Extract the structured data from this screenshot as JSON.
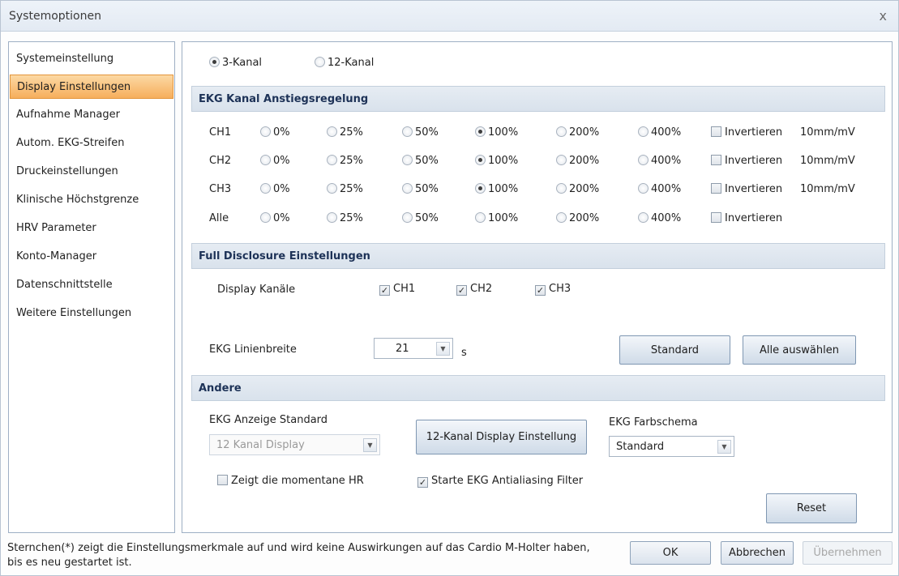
{
  "window": {
    "title": "Systemoptionen",
    "close_glyph": "x"
  },
  "sidebar": {
    "items": [
      {
        "label": "Systemeinstellung"
      },
      {
        "label": "Display Einstellungen"
      },
      {
        "label": "Aufnahme Manager"
      },
      {
        "label": "Autom. EKG-Streifen"
      },
      {
        "label": "Druckeinstellungen"
      },
      {
        "label": "Klinische Höchstgrenze"
      },
      {
        "label": "HRV Parameter"
      },
      {
        "label": "Konto-Manager"
      },
      {
        "label": "Datenschnittstelle"
      },
      {
        "label": "Weitere Einstellungen"
      }
    ],
    "active_index": 1
  },
  "channel_mode": {
    "options": [
      {
        "label": "3-Kanal",
        "selected": true
      },
      {
        "label": "12-Kanal",
        "selected": false
      }
    ]
  },
  "gain_section": {
    "title": "EKG Kanal Anstiegsregelung",
    "percent_options": [
      "0%",
      "25%",
      "50%",
      "100%",
      "200%",
      "400%"
    ],
    "invert_label": "Invertieren",
    "rows": [
      {
        "label": "CH1",
        "selected": "100%",
        "inverted": false,
        "scale": "10mm/mV"
      },
      {
        "label": "CH2",
        "selected": "100%",
        "inverted": false,
        "scale": "10mm/mV"
      },
      {
        "label": "CH3",
        "selected": "100%",
        "inverted": false,
        "scale": "10mm/mV"
      },
      {
        "label": "Alle",
        "selected": "",
        "inverted": false,
        "scale": ""
      }
    ]
  },
  "full_disclosure": {
    "title": "Full Disclosure Einstellungen",
    "display_channels_label": "Display Kanäle",
    "channels": [
      {
        "label": "CH1",
        "checked": true
      },
      {
        "label": "CH2",
        "checked": true
      },
      {
        "label": "CH3",
        "checked": true
      }
    ],
    "line_width_label": "EKG Linienbreite",
    "line_width_value": "21",
    "line_width_unit": "s",
    "standard_button": "Standard",
    "select_all_button": "Alle auswählen"
  },
  "other": {
    "title": "Andere",
    "display_default_label": "EKG Anzeige Standard",
    "display_default_value": "12 Kanal Display",
    "twelve_channel_button": "12-Kanal Display Einstellung",
    "color_scheme_label": "EKG Farbschema",
    "color_scheme_value": "Standard",
    "show_hr_label": "Zeigt die momentane HR",
    "show_hr_checked": false,
    "antialias_label": "Starte EKG Antialiasing Filter",
    "antialias_checked": true,
    "reset_button": "Reset"
  },
  "footer": {
    "note": "Sternchen(*) zeigt die Einstellungsmerkmale auf und wird keine Auswirkungen auf das Cardio M-Holter haben, bis es neu gestartet ist.",
    "ok": "OK",
    "cancel": "Abbrechen",
    "apply": "Übernehmen"
  },
  "colors": {
    "active_item": "#f6ae5c",
    "section_header": "#d9e2ec",
    "section_text": "#1d3257"
  }
}
